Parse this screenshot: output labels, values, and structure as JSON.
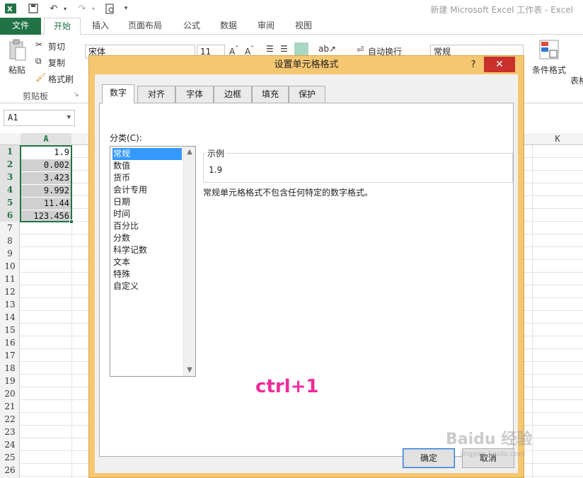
{
  "app": {
    "title": "新建 Microsoft Excel 工作表 - Excel"
  },
  "ribbon_tabs": [
    "文件",
    "开始",
    "插入",
    "页面布局",
    "公式",
    "数据",
    "审阅",
    "视图"
  ],
  "ribbon": {
    "paste": "粘贴",
    "cut": "剪切",
    "copy": "复制",
    "format_painter": "格式刷",
    "clipboard_group": "剪贴板",
    "font_name": "宋体",
    "font_size": "11",
    "wrap_text": "自动换行",
    "number_format": "常规",
    "conditional_format": "条件格式",
    "table_format": "表格"
  },
  "name_box": "A1",
  "columns": [
    "A",
    "K"
  ],
  "rows": [
    "1",
    "2",
    "3",
    "4",
    "5",
    "6",
    "7",
    "8",
    "9",
    "10",
    "11",
    "12",
    "13",
    "14",
    "15",
    "16",
    "17",
    "18",
    "19",
    "20",
    "21",
    "22",
    "23",
    "24",
    "25",
    "26"
  ],
  "cells": [
    "1.9",
    "0.002",
    "3.423",
    "9.992",
    "11.44",
    "123.456"
  ],
  "dialog": {
    "title": "设置单元格格式",
    "help": "?",
    "close": "✕",
    "tabs": [
      "数字",
      "对齐",
      "字体",
      "边框",
      "填充",
      "保护"
    ],
    "category_label": "分类(C):",
    "categories": [
      "常规",
      "数值",
      "货币",
      "会计专用",
      "日期",
      "时间",
      "百分比",
      "分数",
      "科学记数",
      "文本",
      "特殊",
      "自定义"
    ],
    "sample_label": "示例",
    "sample_value": "1.9",
    "description": "常规单元格格式不包含任何特定的数字格式。",
    "ok": "确定",
    "cancel": "取消"
  },
  "overlay": "ctrl+1",
  "watermark": {
    "main": "Baidu 经验",
    "sub": "jingyan.baidu.com"
  },
  "colors": {
    "excel_green": "#217346",
    "dialog_frame": "#f5c771",
    "close_red": "#c7302b",
    "selection_blue": "#3399ff",
    "overlay_pink": "#ee2b9a"
  }
}
